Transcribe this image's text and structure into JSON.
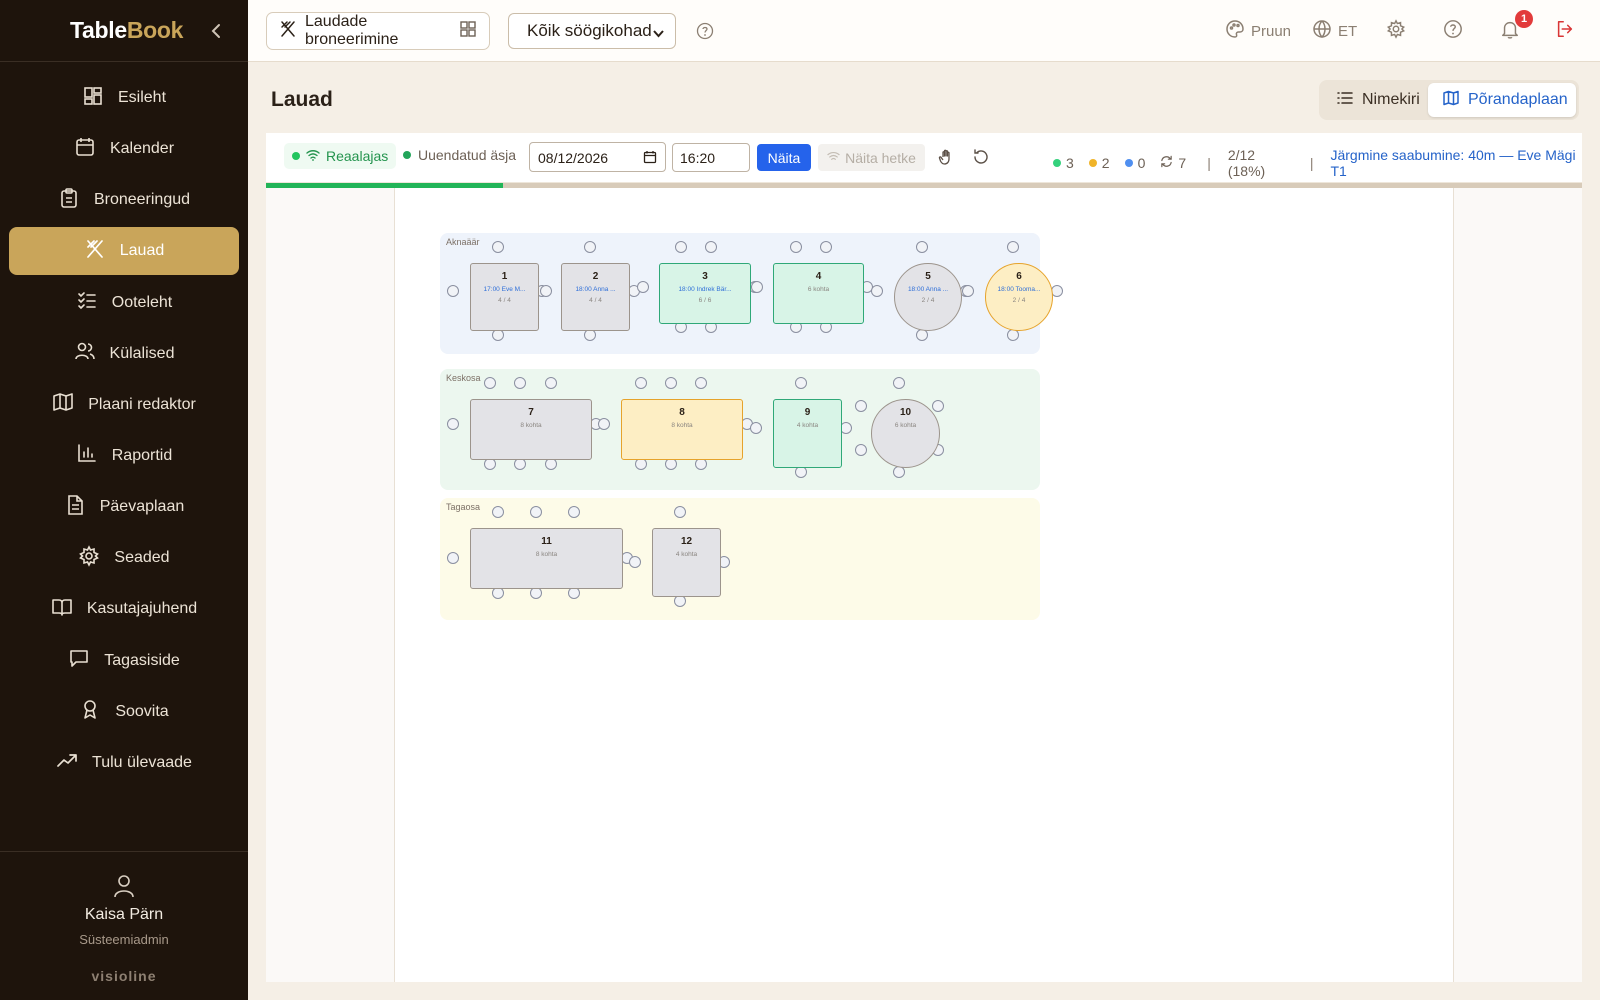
{
  "app": {
    "brand_part1": "Table",
    "brand_part2": "Book"
  },
  "sidebar": {
    "items": [
      {
        "label": "Esileht",
        "icon": "dashboard-icon"
      },
      {
        "label": "Kalender",
        "icon": "calendar-icon"
      },
      {
        "label": "Broneeringud",
        "icon": "clipboard-icon"
      },
      {
        "label": "Lauad",
        "icon": "utensils-icon",
        "active": true
      },
      {
        "label": "Ootelеht",
        "icon": "checklist-icon"
      },
      {
        "label": "Külalised",
        "icon": "users-icon"
      },
      {
        "label": "Plaani redaktor",
        "icon": "map-icon"
      },
      {
        "label": "Raportid",
        "icon": "bar-chart-icon"
      },
      {
        "label": "Päevaplaan",
        "icon": "document-icon"
      },
      {
        "label": "Seaded",
        "icon": "gear-icon"
      },
      {
        "label": "Kasutajajuhend",
        "icon": "book-icon"
      },
      {
        "label": "Tagasiside",
        "icon": "message-icon"
      },
      {
        "label": "Soovita",
        "icon": "award-icon"
      },
      {
        "label": "Tulu ülevaade",
        "icon": "trending-up-icon"
      }
    ],
    "user_name": "Kaisa Pärn",
    "user_role": "Süsteemiadmin",
    "company": "visioline"
  },
  "topbar": {
    "mode_label": "Laudade broneerimine",
    "venue_selected": "Kõik söögikohad",
    "theme_label": "Pruun",
    "lang_label": "ET",
    "notif_count": "1"
  },
  "page": {
    "title": "Lauad",
    "view_list": "Nimekiri",
    "view_floor": "Põrandaplaan"
  },
  "toolbar": {
    "realtime": "Reaalajas",
    "updated": "Uuendatud äsja",
    "date": "08/12/2026",
    "time": "16:20",
    "show": "Näita",
    "show_moment": "Näita hetke",
    "count_free": "3",
    "count_reserved": "2",
    "count_seated": "0",
    "count_turnover": "7",
    "occupancy": "2/12 (18%)",
    "next_arrival": "Järgmine saabumine: 40m — Eve Mägi T1",
    "progress_fraction": 0.18
  },
  "colors": {
    "free": "#22c55e",
    "reserved": "#f0b429",
    "seated": "#4f8ff0",
    "accent": "#c9a55a",
    "primary_blue": "#2563eb"
  },
  "floor": {
    "zones": [
      {
        "name": "Aknaäär"
      },
      {
        "name": "Keskosa"
      },
      {
        "name": "Tagaosa"
      }
    ],
    "tables": [
      {
        "num": "1",
        "label": "17:00 Eve M...",
        "cap": "4 / 4",
        "status": "occupied"
      },
      {
        "num": "2",
        "label": "18:00 Anna ...",
        "cap": "4 / 4",
        "status": "occupied"
      },
      {
        "num": "3",
        "label": "18:00 Indrek Bär...",
        "cap": "6 / 6",
        "status": "free"
      },
      {
        "num": "4",
        "label": "6 kohta",
        "cap": "",
        "status": "free"
      },
      {
        "num": "5",
        "label": "18:00 Anna ...",
        "cap": "2 / 4",
        "status": "occupied"
      },
      {
        "num": "6",
        "label": "18:00 Tooma...",
        "cap": "2 / 4",
        "status": "warn"
      },
      {
        "num": "7",
        "label": "8 kohta",
        "cap": "",
        "status": "occupied"
      },
      {
        "num": "8",
        "label": "8 kohta",
        "cap": "",
        "status": "warn"
      },
      {
        "num": "9",
        "label": "4 kohta",
        "cap": "",
        "status": "free"
      },
      {
        "num": "10",
        "label": "6 kohta",
        "cap": "",
        "status": "occupied"
      },
      {
        "num": "11",
        "label": "8 kohta",
        "cap": "",
        "status": "occupied"
      },
      {
        "num": "12",
        "label": "4 kohta",
        "cap": "",
        "status": "occupied"
      }
    ]
  }
}
